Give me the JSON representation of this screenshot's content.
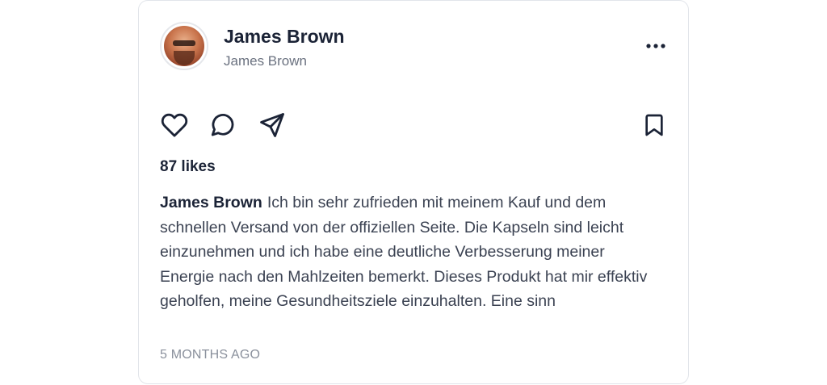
{
  "post": {
    "author_name": "James Brown",
    "author_handle": "James Brown",
    "likes": "87 likes",
    "caption_author": "James Brown",
    "caption_text": "Ich bin sehr zufrieden mit meinem Kauf und dem schnellen Versand von der offiziellen Seite. Die Kapseln sind leicht einzunehmen und ich habe eine deutliche Verbesserung meiner Energie nach den Mahlzeiten bemerkt. Dieses Produkt hat mir effektiv geholfen, meine Gesundheitsziele einzuhalten. Eine sinn",
    "timestamp": "5 MONTHS AGO"
  },
  "icons": {
    "more": "more-horizontal-icon",
    "like": "heart-icon",
    "comment": "comment-icon",
    "share": "send-icon",
    "save": "bookmark-icon"
  },
  "colors": {
    "text_primary": "#1b2336",
    "text_body": "#3b4252",
    "text_muted": "#6b7280",
    "border": "#e2e5ea"
  }
}
